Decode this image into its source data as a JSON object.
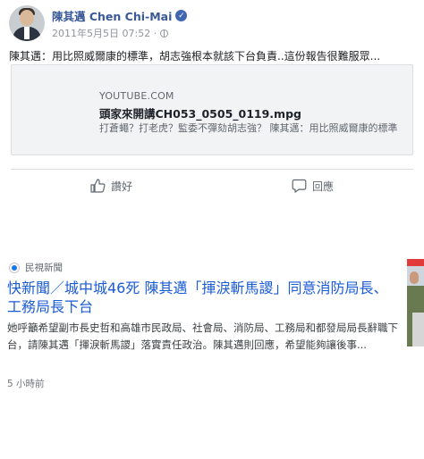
{
  "post": {
    "author": "陳其邁 Chen Chi-Mai",
    "timestamp": "2011年5月5日 07:52 ·",
    "text": "陳其邁：用比照威爾康的標準，胡志強根本就該下台負責..這份報告很難服眾...",
    "link": {
      "domain": "YOUTUBE.COM",
      "title": "頭家來開講CH053_0505_0119.mpg",
      "description": "打蒼蠅？打老虎？監委不彈劾胡志強？ 陳其邁：用比照威爾康的標準"
    },
    "actions": {
      "like": "讚好",
      "reply": "回應"
    }
  },
  "news": {
    "source": "民視新聞",
    "headline": "快新聞／城中城46死 陳其邁「揮淚斬馬謖」同意消防局長、工務局長下台",
    "summary": "她呼籲希望副市長史哲和高雄市民政局、社會局、消防局、工務局和都發局局長辭職下台，請陳其邁「揮淚斬馬謖」落實責任政治。陳其邁則回應，希望能夠讓後事...",
    "time": "5 小時前"
  },
  "colors": {
    "name_link": "#385898",
    "headline_link": "#1a5bd6",
    "verified_badge": "#4267b2"
  },
  "icons": {
    "verified": "verified-badge-icon",
    "privacy": "globe-icon",
    "like": "thumbs-up-icon",
    "reply": "comment-bubble-icon",
    "source": "source-logo-icon"
  }
}
